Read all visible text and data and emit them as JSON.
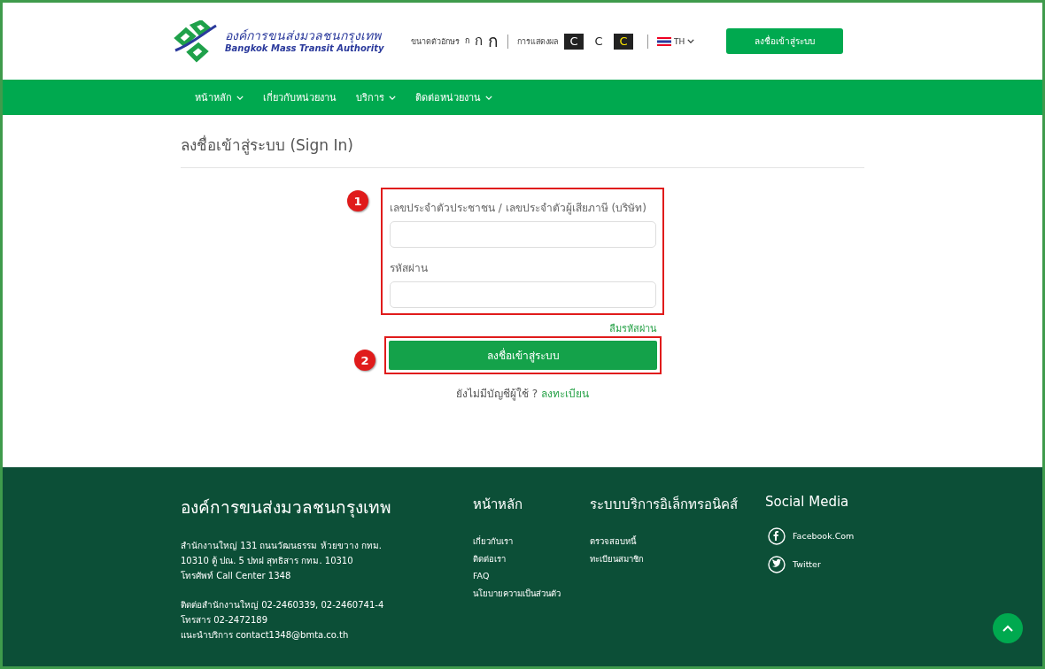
{
  "header": {
    "logo": {
      "name_th": "องค์การขนส่งมวลชนกรุงเทพ",
      "name_en": "Bangkok Mass Transit Authority"
    },
    "font_size": {
      "label": "ขนาดตัวอักษร",
      "options": [
        {
          "label": "ก",
          "kind": "small"
        },
        {
          "label": "ก",
          "kind": "medium"
        },
        {
          "label": "ก",
          "kind": "large"
        }
      ]
    },
    "display": {
      "label": "การแสดงผล",
      "options": [
        {
          "label": "C",
          "kind": "dark"
        },
        {
          "label": "C",
          "kind": "light"
        },
        {
          "label": "C",
          "kind": "yellow"
        }
      ]
    },
    "language": "TH",
    "signin_button": "ลงชื่อเข้าสู่ระบบ"
  },
  "nav": [
    {
      "label": "หน้าหลัก",
      "dropdown": true
    },
    {
      "label": "เกี่ยวกับหน่วยงาน",
      "dropdown": false
    },
    {
      "label": "บริการ",
      "dropdown": true
    },
    {
      "label": "ติดต่อหน่วยงาน",
      "dropdown": true
    }
  ],
  "page_title": "ลงชื่อเข้าสู่ระบบ (Sign In)",
  "form": {
    "id_label": "เลขประจำตัวประชาชน / เลขประจำตัวผู้เสียภาษี (บริษัท)",
    "password_label": "รหัสผ่าน",
    "forgot_link": "ลืมรหัสผ่าน",
    "submit": "ลงชื่อเข้าสู่ระบบ",
    "no_account": "ยังไม่มีบัญชีผู้ใช้ ?",
    "register_link": "ลงทะเบียน"
  },
  "annotations": [
    "1",
    "2"
  ],
  "footer": {
    "org": {
      "title": "องค์การขนส่งมวลชนกรุงเทพ",
      "address": [
        "สำนักงานใหญ่ 131 ถนนวัฒนธรรม ห้วยขวาง กทม.",
        "10310 ตู้ ปณ. 5 ปทฝ สุทธิสาร กทม. 10310",
        "โทรศัพท์ Call Center 1348"
      ],
      "contact": [
        "ติดต่อสำนักงานใหญ่ 02-2460339, 02-2460741-4",
        "โทรสาร 02-2472189",
        "แนะนำบริการ contact1348@bmta.co.th"
      ]
    },
    "home": {
      "title": "หน้าหลัก",
      "links": [
        "เกี่ยวกับเรา",
        "ติดต่อเรา",
        "FAQ",
        "นโยบายความเป็นส่วนตัว"
      ]
    },
    "eservices": {
      "title": "ระบบบริการอิเล็กทรอนิคส์",
      "links": [
        "ตรวจสอบหนี้",
        "ทะเบียนสมาชิก"
      ]
    },
    "social": {
      "title": "Social Media",
      "links": [
        {
          "label": "Facebook.Com",
          "kind": "facebook"
        },
        {
          "label": "Twitter",
          "kind": "twitter"
        }
      ]
    }
  }
}
